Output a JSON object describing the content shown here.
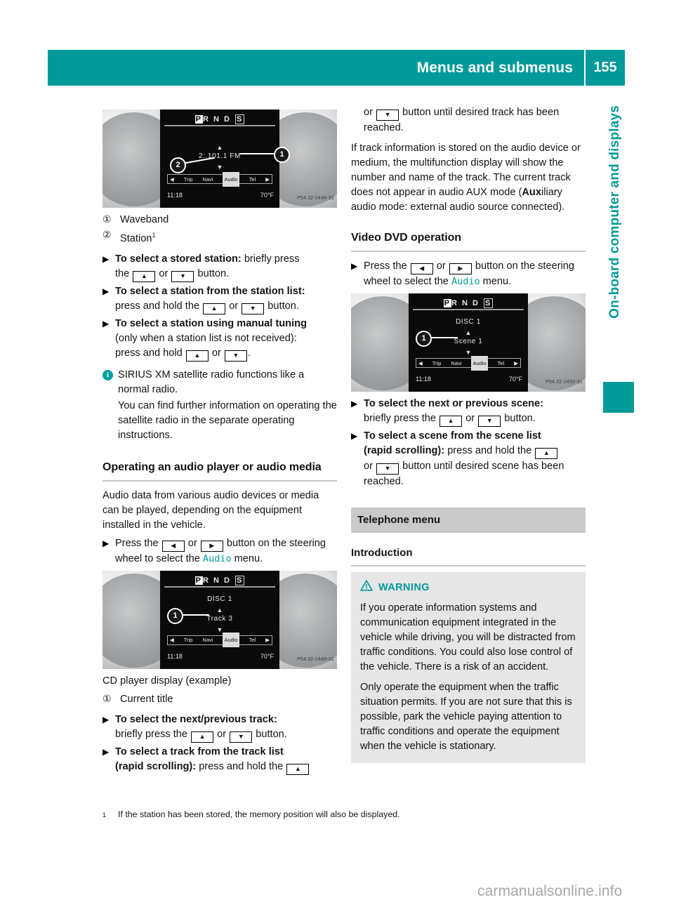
{
  "header": {
    "title": "Menus and submenus",
    "page_number": "155"
  },
  "side_tab": {
    "label": "On-board computer and displays"
  },
  "figures": {
    "radio": {
      "gear_p": "P",
      "gear_rnd": "R N D",
      "gear_s": "S",
      "line_main": "2:.101.1 FM",
      "up_arrow": "▲",
      "down_arrow": "▼",
      "menu_trip": "Trip",
      "menu_navi": "Navi",
      "menu_audio": "Audio",
      "menu_tel": "Tel",
      "menu_left_arrow": "◀",
      "menu_right_arrow": "▶",
      "clock": "11:18",
      "temperature": "70°F",
      "image_code": "P54.32-2448-31",
      "callout_1": "1",
      "callout_2": "2"
    },
    "cd": {
      "gear_p": "P",
      "gear_rnd": "R N D",
      "gear_s": "S",
      "line_disc": "DISC 1",
      "line_main": "Track 3",
      "up_arrow": "▲",
      "down_arrow": "▼",
      "menu_trip": "Trip",
      "menu_navi": "Navi",
      "menu_audio": "Audio",
      "menu_tel": "Tel",
      "menu_left_arrow": "◀",
      "menu_right_arrow": "▶",
      "clock": "11:18",
      "temperature": "70°F",
      "image_code": "P54.32-2449-31",
      "callout_1": "1"
    },
    "dvd": {
      "gear_p": "P",
      "gear_rnd": "R N D",
      "gear_s": "S",
      "line_disc": "DISC 1",
      "line_main": "Scene 1",
      "up_arrow": "▲",
      "down_arrow": "▼",
      "menu_trip": "Trip",
      "menu_navi": "Navi",
      "menu_audio": "Audio",
      "menu_tel": "Tel",
      "menu_left_arrow": "◀",
      "menu_right_arrow": "▶",
      "clock": "11:18",
      "temperature": "70°F",
      "image_code": "P54.32-2450-31",
      "callout_1": "1"
    }
  },
  "left_column": {
    "legend": [
      {
        "num": "①",
        "text": "Waveband"
      },
      {
        "num": "②",
        "text": "Station",
        "footnote": "1"
      }
    ],
    "bullet_marker": "X",
    "triangle_marker": "▶",
    "items": [
      {
        "bold": "To select a stored station:",
        "rest_a": " briefly press",
        "line2_pre": "the ",
        "key1": "▲",
        "mid": " or ",
        "key2": "▼",
        "line2_post": " button."
      },
      {
        "bold": "To select a station from the station list:",
        "line2_pre": "press and hold the ",
        "key1": "▲",
        "mid": " or ",
        "key2": "▼",
        "line2_post": " button."
      },
      {
        "bold": "To select a station using manual tuning",
        "line2": "(only when a station list is not received):",
        "line3_pre": "press and hold ",
        "key1": "▲",
        "mid": " or ",
        "key2": "▼",
        "line3_post": "."
      }
    ],
    "info_note": {
      "icon": "i",
      "p1": "SIRIUS XM satellite radio functions like a normal radio.",
      "p2": "You can find further information on operating the satellite radio in the separate operating instructions."
    },
    "section_heading": "Operating an audio player or audio media",
    "body_paragraph": "Audio data from various audio devices or media can be played, depending on the equipment installed in the vehicle.",
    "press_instruction": {
      "pre": "Press the ",
      "key1": "◀",
      "mid": " or ",
      "key2": "▶",
      "post": " button on the steering wheel to select the ",
      "menu_name": "Audio",
      "tail": " menu."
    },
    "figure_caption": "CD player display (example)",
    "figure_legend": [
      {
        "num": "①",
        "text": "Current title"
      }
    ],
    "track_items": [
      {
        "bold": "To select the next/previous track:",
        "line2_pre": "briefly press the ",
        "key1": "▲",
        "mid": " or ",
        "key2": "▼",
        "line2_post": " button."
      },
      {
        "bold": "To select a track from the track list",
        "bold2": "(rapid scrolling):",
        "rest": " press and hold the ",
        "key1": "▲"
      }
    ]
  },
  "right_column": {
    "continuation": {
      "pre": "or ",
      "key": "▼",
      "post": " button until desired track has been reached."
    },
    "paragraph": {
      "a": "If track information is stored on the audio device or medium, the multifunction display will show the number and name of the track. The current track does not appear in audio AUX mode (",
      "bold": "Aux",
      "b": "iliary audio mode: external audio source connected)."
    },
    "section_heading": "Video DVD operation",
    "press_instruction": {
      "pre": "Press the ",
      "key1": "◀",
      "mid": " or ",
      "key2": "▶",
      "post": " button on the steering wheel to select the ",
      "menu_name": "Audio",
      "tail": " menu."
    },
    "scene_items": [
      {
        "bold": "To select the next or previous scene:",
        "line2_pre": "briefly press the ",
        "key1": "▲",
        "mid": " or ",
        "key2": "▼",
        "line2_post": " button."
      },
      {
        "bold": "To select a scene from the scene list",
        "bold2": "(rapid scrolling):",
        "rest": " press and hold the ",
        "key1": "▲",
        "line3_pre": "or ",
        "key2": "▼",
        "line3_post": " button until desired scene has been reached."
      }
    ],
    "gray_bar": "Telephone menu",
    "sub_heading": "Introduction",
    "warning": {
      "icon": "warning-triangle",
      "title": "WARNING",
      "p1": "If you operate information systems and communication equipment integrated in the vehicle while driving, you will be distracted from traffic conditions. You could also lose control of the vehicle. There is a risk of an accident.",
      "p2": "Only operate the equipment when the traffic situation permits. If you are not sure that this is possible, park the vehicle paying attention to traffic conditions and operate the equipment when the vehicle is stationary."
    }
  },
  "footnote": {
    "mark": "1",
    "text": "If the station has been stored, the memory position will also be displayed."
  },
  "watermark": "carmanualsonline.info",
  "colors": {
    "teal": "#009a9a",
    "gray_bar": "#c9c9c9",
    "warn_bg": "#e6e6e6"
  }
}
